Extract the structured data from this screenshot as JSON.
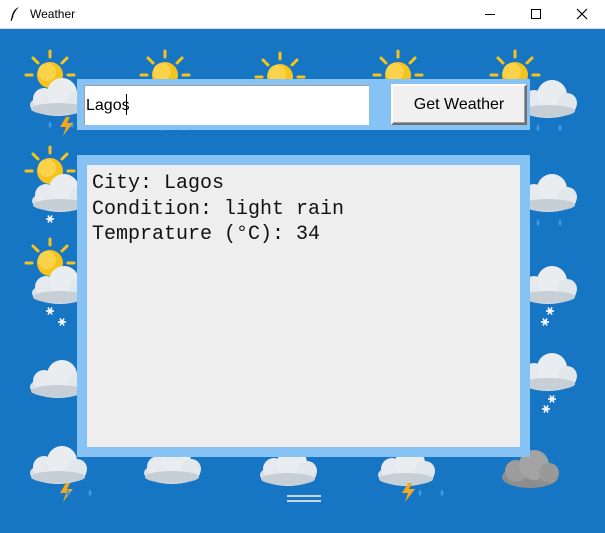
{
  "window": {
    "title": "Weather",
    "icons": {
      "app": "feather-icon",
      "minimize": "minimize-icon",
      "maximize": "maximize-icon",
      "close": "close-icon"
    }
  },
  "search": {
    "value": "Lagos",
    "button_label": "Get Weather"
  },
  "result": {
    "lines": [
      "City: Lagos",
      "Condition: light rain",
      "Temprature (°C): 34"
    ]
  },
  "background": {
    "tile_icon": "weather-tile-icon",
    "colors": {
      "sky": "#1776c4",
      "frame": "#87c2f5",
      "sun": "#f6c21c",
      "cloud": "#dde3e8",
      "dark_cloud": "#9a9a9a",
      "rain": "#3a9be8",
      "lightning": "#f4a71c"
    }
  }
}
